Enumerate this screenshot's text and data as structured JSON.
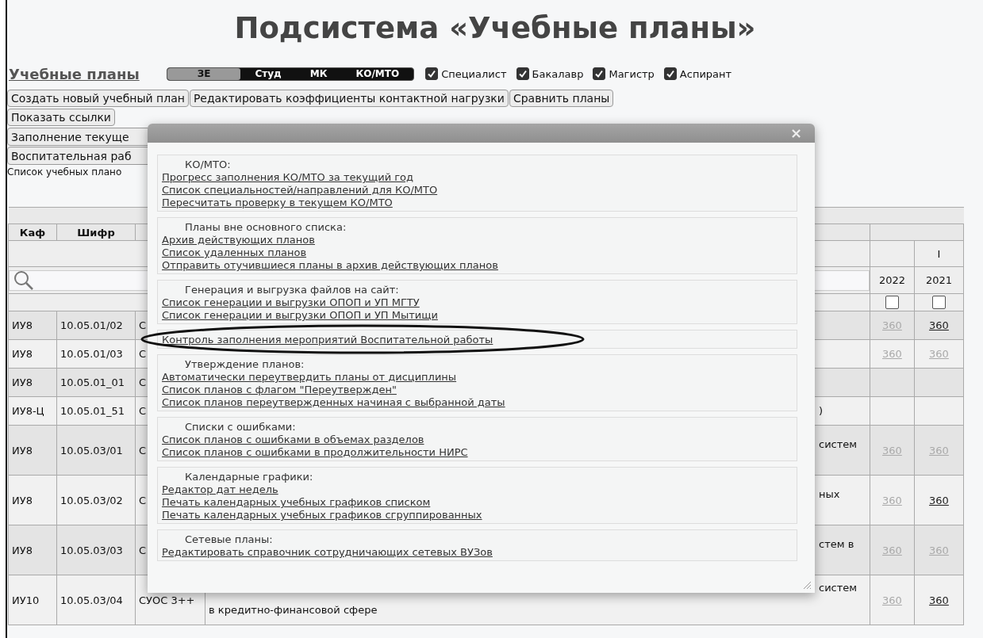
{
  "page_title": "Подсистема «Учебные планы»",
  "section_link": "Учебные планы",
  "modes": [
    {
      "label": "ЗЕ",
      "selected": true
    },
    {
      "label": "Студ",
      "selected": false
    },
    {
      "label": "МК",
      "selected": false
    },
    {
      "label": "КО/МТО",
      "selected": false
    }
  ],
  "levels": [
    {
      "label": "Специалист",
      "checked": true
    },
    {
      "label": "Бакалавр",
      "checked": true
    },
    {
      "label": "Магистр",
      "checked": true
    },
    {
      "label": "Аспирант",
      "checked": true
    }
  ],
  "buttons": [
    "Создать новый учебный план",
    "Редактировать коэффициенты контактной нагрузки",
    "Сравнить планы"
  ],
  "buttons_2": [
    "Показать ссылки"
  ],
  "wide_buttons": [
    "Заполнение текуще",
    "Воспитательная раб"
  ],
  "list_caption": "Список учебных плано",
  "table": {
    "columns": [
      "Каф",
      "Шифр"
    ],
    "group_header": "I",
    "years": [
      {
        "label": "2022",
        "checked": false
      },
      {
        "label": "2021",
        "checked": false
      }
    ],
    "rows": [
      {
        "dept": "ИУ8",
        "code": "10.05.01/02",
        "column_3": "С",
        "values": [
          {
            "text": "360",
            "dim": true
          },
          {
            "text": "360",
            "dim": false
          }
        ]
      },
      {
        "dept": "ИУ8",
        "code": "10.05.01/03",
        "column_3": "С",
        "values": [
          {
            "text": "360",
            "dim": true
          },
          {
            "text": "360",
            "dim": true
          }
        ]
      },
      {
        "dept": "ИУ8",
        "code": "10.05.01_01",
        "column_3": "С"
      },
      {
        "dept": "ИУ8-Ц",
        "code": "10.05.01_51",
        "column_3": "С",
        "column_4": {
          "tail": ")"
        }
      },
      {
        "dept": "ИУ8",
        "code": "10.05.03/01",
        "column_3": "С",
        "column_4": {
          "tail": "систем"
        },
        "values": [
          {
            "text": "360",
            "dim": true
          },
          {
            "text": "360",
            "dim": true
          }
        ]
      },
      {
        "dept": "ИУ8",
        "code": "10.05.03/02",
        "column_3": "С",
        "column_4": {
          "tail": "ных"
        },
        "values": [
          {
            "text": "360",
            "dim": true
          },
          {
            "text": "360",
            "dim": false
          }
        ]
      },
      {
        "dept": "ИУ8",
        "code": "10.05.03/03",
        "column_3": "С",
        "column_4": {
          "tail": "стем в"
        },
        "values": [
          {
            "text": "360",
            "dim": true
          },
          {
            "text": "360",
            "dim": true
          }
        ]
      },
      {
        "dept": "ИУ10",
        "code": "10.05.03/04",
        "column_3": "СУОС 3++",
        "column_4": {
          "tail": "систем",
          "continuation": "в кредитно-финансовой сфере"
        },
        "values": [
          {
            "text": "360",
            "dim": true
          },
          {
            "text": "360",
            "dim": false
          }
        ]
      }
    ]
  },
  "dialog": {
    "close": "×",
    "sections": [
      {
        "heading": "КО/МТО:",
        "circled": false,
        "links": [
          "Прогресс заполнения КО/МТО за текущий год",
          "Список специальностей/направлений для КО/МТО",
          "Пересчитать проверку в текущем КО/МТО"
        ]
      },
      {
        "heading": "Планы вне основного списка:",
        "circled": false,
        "links": [
          "Архив действующих планов",
          "Список удаленных планов",
          "Отправить отучившиеся планы в архив действующих планов"
        ]
      },
      {
        "heading": "Генерация и выгрузка файлов на сайт:",
        "circled": false,
        "links": [
          "Список генерации и выгрузки ОПОП и УП МГТУ",
          "Список генерации и выгрузки ОПОП и УП Мытищи"
        ]
      },
      {
        "circled": true,
        "links": [
          "Контроль заполнения мероприятий Воспитательной работы"
        ]
      },
      {
        "heading": "Утверждение планов:",
        "circled": false,
        "links": [
          "Автоматически переутвердить планы от дисциплины",
          "Список планов с флагом \"Переутвержден\"",
          "Список планов переутвержденных начиная с выбранной даты"
        ]
      },
      {
        "heading": "Списки с ошибками:",
        "circled": false,
        "links": [
          "Список планов с ошибками в объемах разделов",
          "Список планов с ошибками в продолжительности НИРС"
        ]
      },
      {
        "heading": "Календарные графики:",
        "circled": false,
        "links": [
          "Редактор дат недель",
          "Печать календарных учебных графиков списком",
          "Печать календарных учебных графиков сгруппированных"
        ]
      },
      {
        "heading": "Сетевые планы:",
        "circled": false,
        "links": [
          "Редактировать справочник сотрудничающих сетевых ВУЗов"
        ]
      }
    ]
  }
}
